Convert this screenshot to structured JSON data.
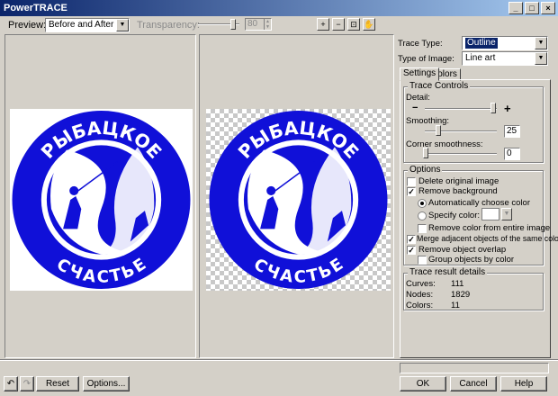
{
  "window": {
    "title": "PowerTRACE",
    "min": "_",
    "max": "□",
    "close": "×"
  },
  "toolbar": {
    "preview_label": "Preview:",
    "preview_value": "Before and After",
    "transparency_label": "Transparency:",
    "transparency_value": "80"
  },
  "tools": {
    "zoom_in": "+",
    "zoom_out": "−",
    "fit": "⊡",
    "pan": "✋"
  },
  "logo": {
    "top_text": "РЫБАЦКОЕ",
    "bottom_text": "СЧАСТЬЕ"
  },
  "right": {
    "trace_type_label": "Trace Type:",
    "trace_type_value": "Outline",
    "image_type_label": "Type of Image:",
    "image_type_value": "Line art",
    "tabs": [
      "Settings",
      "Colors"
    ],
    "trace_controls": {
      "title": "Trace Controls",
      "detail_label": "Detail:",
      "detail_level": 0.92,
      "smoothing_label": "Smoothing:",
      "smoothing_value": "25",
      "corner_label": "Corner smoothness:",
      "corner_value": "0"
    },
    "options": {
      "title": "Options",
      "delete_original": "Delete original image",
      "remove_background": "Remove background",
      "auto_color": "Automatically choose color",
      "specify_color": "Specify color:",
      "remove_entire": "Remove color from entire image",
      "merge_adjacent": "Merge adjacent objects of the same color",
      "remove_overlap": "Remove object overlap",
      "group_by_color": "Group objects by color"
    },
    "results": {
      "title": "Trace result details",
      "curves_label": "Curves:",
      "curves_value": "111",
      "nodes_label": "Nodes:",
      "nodes_value": "1829",
      "colors_label": "Colors:",
      "colors_value": "11"
    }
  },
  "bottom": {
    "reset": "Reset",
    "options": "Options...",
    "ok": "OK",
    "cancel": "Cancel",
    "help": "Help"
  },
  "colors": {
    "logo_blue": "#1010d8",
    "titlebar": "#0a246a"
  }
}
